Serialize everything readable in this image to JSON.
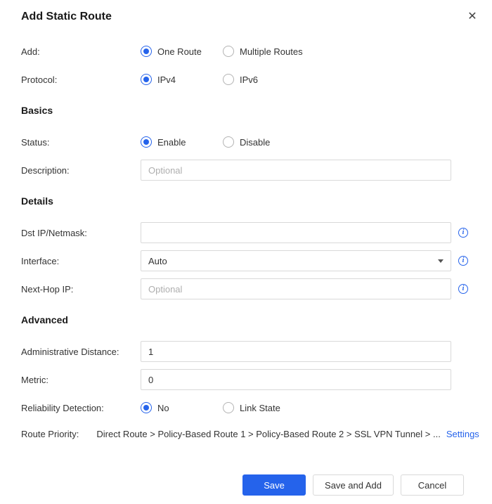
{
  "dialog": {
    "title": "Add Static Route",
    "close_icon": "✕"
  },
  "icons": {
    "info_glyph": "i"
  },
  "sections": {
    "basics": "Basics",
    "details": "Details",
    "advanced": "Advanced"
  },
  "fields": {
    "add": {
      "label": "Add:",
      "options": [
        "One Route",
        "Multiple Routes"
      ],
      "selected": "One Route"
    },
    "protocol": {
      "label": "Protocol:",
      "options": [
        "IPv4",
        "IPv6"
      ],
      "selected": "IPv4"
    },
    "status": {
      "label": "Status:",
      "options": [
        "Enable",
        "Disable"
      ],
      "selected": "Enable"
    },
    "description": {
      "label": "Description:",
      "placeholder": "Optional",
      "value": ""
    },
    "dst_ip_netmask": {
      "label": "Dst IP/Netmask:",
      "value": ""
    },
    "interface": {
      "label": "Interface:",
      "value": "Auto"
    },
    "next_hop_ip": {
      "label": "Next-Hop IP:",
      "placeholder": "Optional",
      "value": ""
    },
    "administrative_distance": {
      "label": "Administrative Distance:",
      "value": "1"
    },
    "metric": {
      "label": "Metric:",
      "value": "0"
    },
    "reliability_detection": {
      "label": "Reliability Detection:",
      "options": [
        "No",
        "Link State"
      ],
      "selected": "No"
    },
    "route_priority": {
      "label": "Route Priority:",
      "value": "Direct Route > Policy-Based Route 1 > Policy-Based Route 2 > SSL VPN Tunnel > ...",
      "settings_link": "Settings"
    }
  },
  "buttons": {
    "save": "Save",
    "save_and_add": "Save and Add",
    "cancel": "Cancel"
  },
  "colors": {
    "primary": "#2563eb"
  }
}
